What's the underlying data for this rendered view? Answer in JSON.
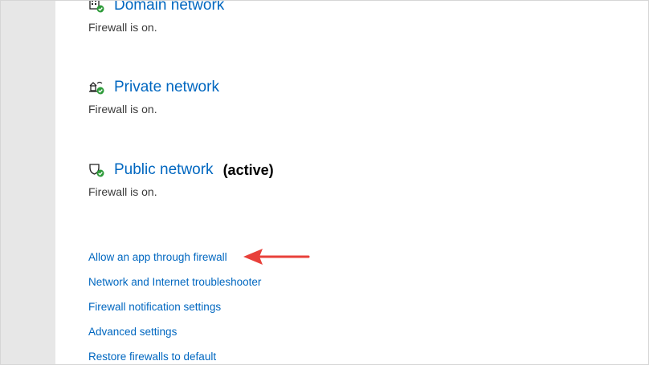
{
  "networks": [
    {
      "name": "Domain network",
      "active_label": "",
      "status": "Firewall is on.",
      "icon": "domain-network-icon"
    },
    {
      "name": "Private network",
      "active_label": "",
      "status": "Firewall is on.",
      "icon": "private-network-icon"
    },
    {
      "name": "Public network",
      "active_label": "(active)",
      "status": "Firewall is on.",
      "icon": "public-network-icon"
    }
  ],
  "links": [
    {
      "label": "Allow an app through firewall"
    },
    {
      "label": "Network and Internet troubleshooter"
    },
    {
      "label": "Firewall notification settings"
    },
    {
      "label": "Advanced settings"
    },
    {
      "label": "Restore firewalls to default"
    }
  ],
  "colors": {
    "link": "#0067c0",
    "status_check": "#2e9b3a",
    "annotation_arrow": "#e8403a",
    "rail": "#e7e7e7"
  },
  "annotation": {
    "icon": "red-arrow-icon"
  }
}
